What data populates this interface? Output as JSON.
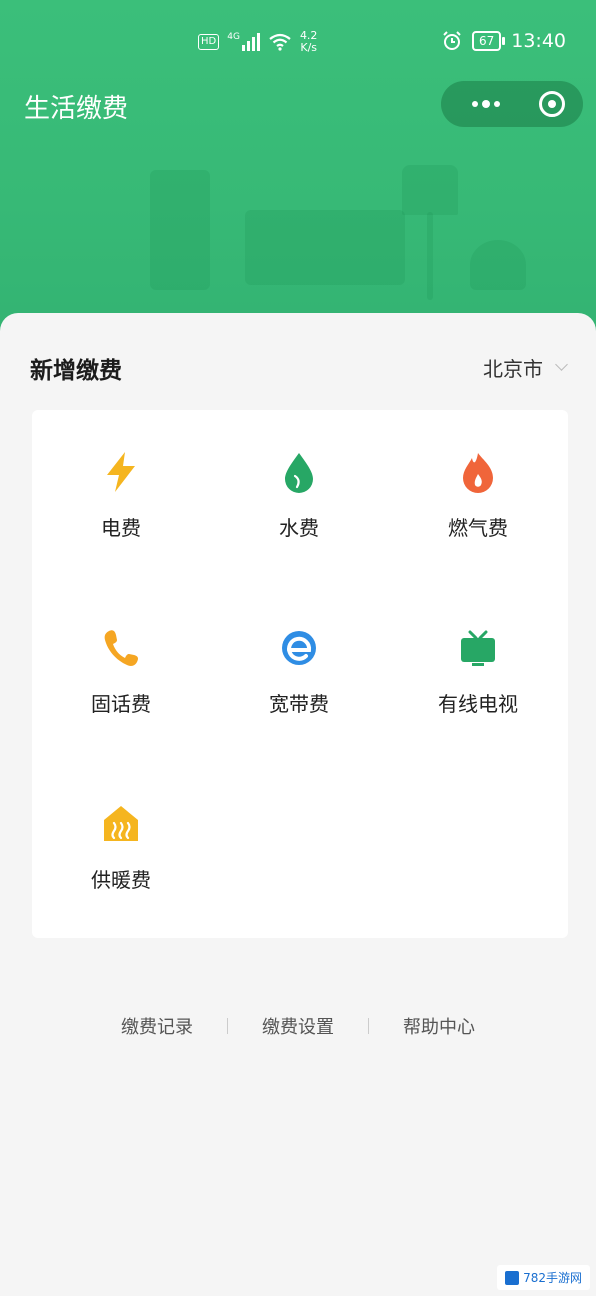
{
  "status_bar": {
    "hd": "HD",
    "net": "4G",
    "speed_value": "4.2",
    "speed_unit": "K/s",
    "battery": "67",
    "time": "13:40"
  },
  "header": {
    "title": "生活缴费"
  },
  "section": {
    "title": "新增缴费",
    "city": "北京市"
  },
  "services": [
    {
      "label": "电费",
      "icon": "lightning-icon",
      "color": "#f5b51f"
    },
    {
      "label": "水费",
      "icon": "water-drop-icon",
      "color": "#27a765"
    },
    {
      "label": "燃气费",
      "icon": "flame-icon",
      "color": "#f0653a"
    },
    {
      "label": "固话费",
      "icon": "phone-icon",
      "color": "#f5a623"
    },
    {
      "label": "宽带费",
      "icon": "broadband-icon",
      "color": "#2f8de4"
    },
    {
      "label": "有线电视",
      "icon": "tv-icon",
      "color": "#27a765"
    },
    {
      "label": "供暖费",
      "icon": "heating-icon",
      "color": "#f5b51f"
    }
  ],
  "footer_links": [
    "缴费记录",
    "缴费设置",
    "帮助中心"
  ],
  "watermark": "782手游网"
}
